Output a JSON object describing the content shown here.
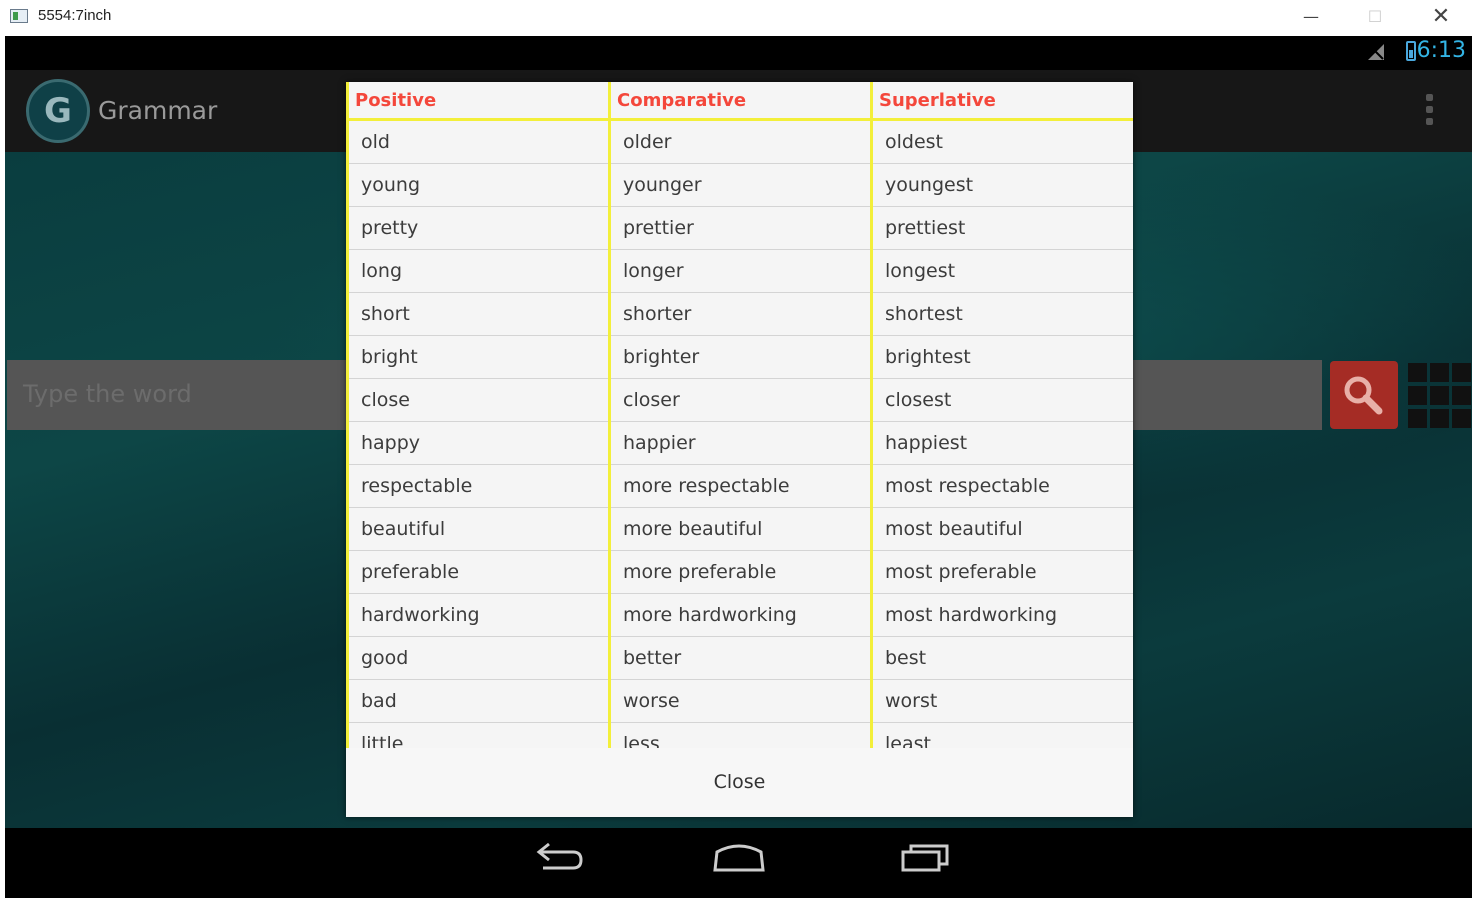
{
  "window": {
    "title": "5554:7inch"
  },
  "status": {
    "time": "6:13"
  },
  "app": {
    "logo_letter": "G",
    "title": "Grammar"
  },
  "search": {
    "placeholder": "Type the word"
  },
  "dialog": {
    "headers": [
      "Positive",
      "Comparative",
      "Superlative"
    ],
    "rows": [
      [
        "old",
        "older",
        "oldest"
      ],
      [
        "young",
        "younger",
        "youngest"
      ],
      [
        "pretty",
        "prettier",
        "prettiest"
      ],
      [
        "long",
        "longer",
        "longest"
      ],
      [
        "short",
        "shorter",
        "shortest"
      ],
      [
        "bright",
        "brighter",
        "brightest"
      ],
      [
        "close",
        "closer",
        "closest"
      ],
      [
        "happy",
        "happier",
        "happiest"
      ],
      [
        "respectable",
        "more respectable",
        "most respectable"
      ],
      [
        "beautiful",
        "more beautiful",
        "most beautiful"
      ],
      [
        "preferable",
        "more preferable",
        "most preferable"
      ],
      [
        "hardworking",
        "more hardworking",
        "most hardworking"
      ],
      [
        "good",
        "better",
        "best"
      ],
      [
        "bad",
        "worse",
        "worst"
      ],
      [
        "little",
        "less",
        "least"
      ]
    ],
    "close_label": "Close"
  },
  "colors": {
    "header_text": "#f4473b",
    "divider": "#f3ef3a",
    "accent": "#33b5e5",
    "search_button": "#a52c25"
  }
}
